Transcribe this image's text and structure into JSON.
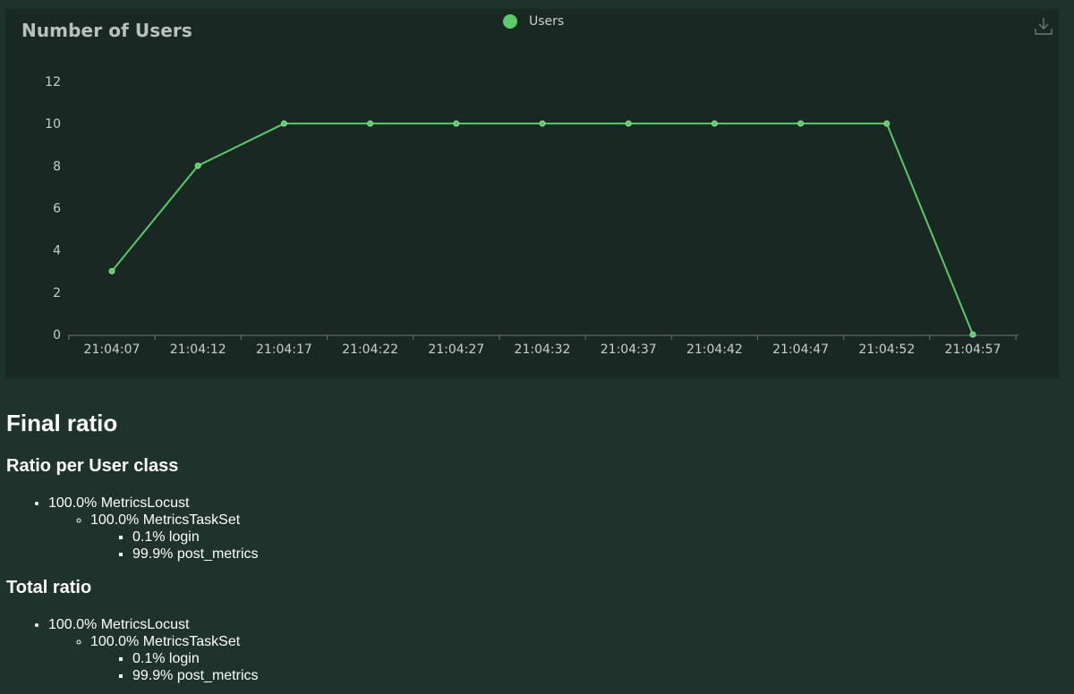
{
  "chart": {
    "title": "Number of Users",
    "download_icon": "download-icon",
    "line_color": "#5bc86a"
  },
  "chart_data": {
    "type": "line",
    "title": "Number of Users",
    "xlabel": "",
    "ylabel": "",
    "categories": [
      "21:04:07",
      "21:04:12",
      "21:04:17",
      "21:04:22",
      "21:04:27",
      "21:04:32",
      "21:04:37",
      "21:04:42",
      "21:04:47",
      "21:04:52",
      "21:04:57"
    ],
    "series": [
      {
        "name": "Users",
        "values": [
          3,
          8,
          10,
          10,
          10,
          10,
          10,
          10,
          10,
          10,
          0
        ]
      }
    ],
    "ylim": [
      0,
      12
    ],
    "yticks": [
      0,
      2,
      4,
      6,
      8,
      10,
      12
    ],
    "grid": false,
    "legend": "top-center"
  },
  "final_ratio": {
    "heading": "Final ratio",
    "per_class": {
      "heading": "Ratio per User class",
      "user": "100.0% MetricsLocust",
      "taskset": "100.0% MetricsTaskSet",
      "tasks": [
        "0.1% login",
        "99.9% post_metrics"
      ]
    },
    "total": {
      "heading": "Total ratio",
      "user": "100.0% MetricsLocust",
      "taskset": "100.0% MetricsTaskSet",
      "tasks": [
        "0.1% login",
        "99.9% post_metrics"
      ]
    }
  }
}
